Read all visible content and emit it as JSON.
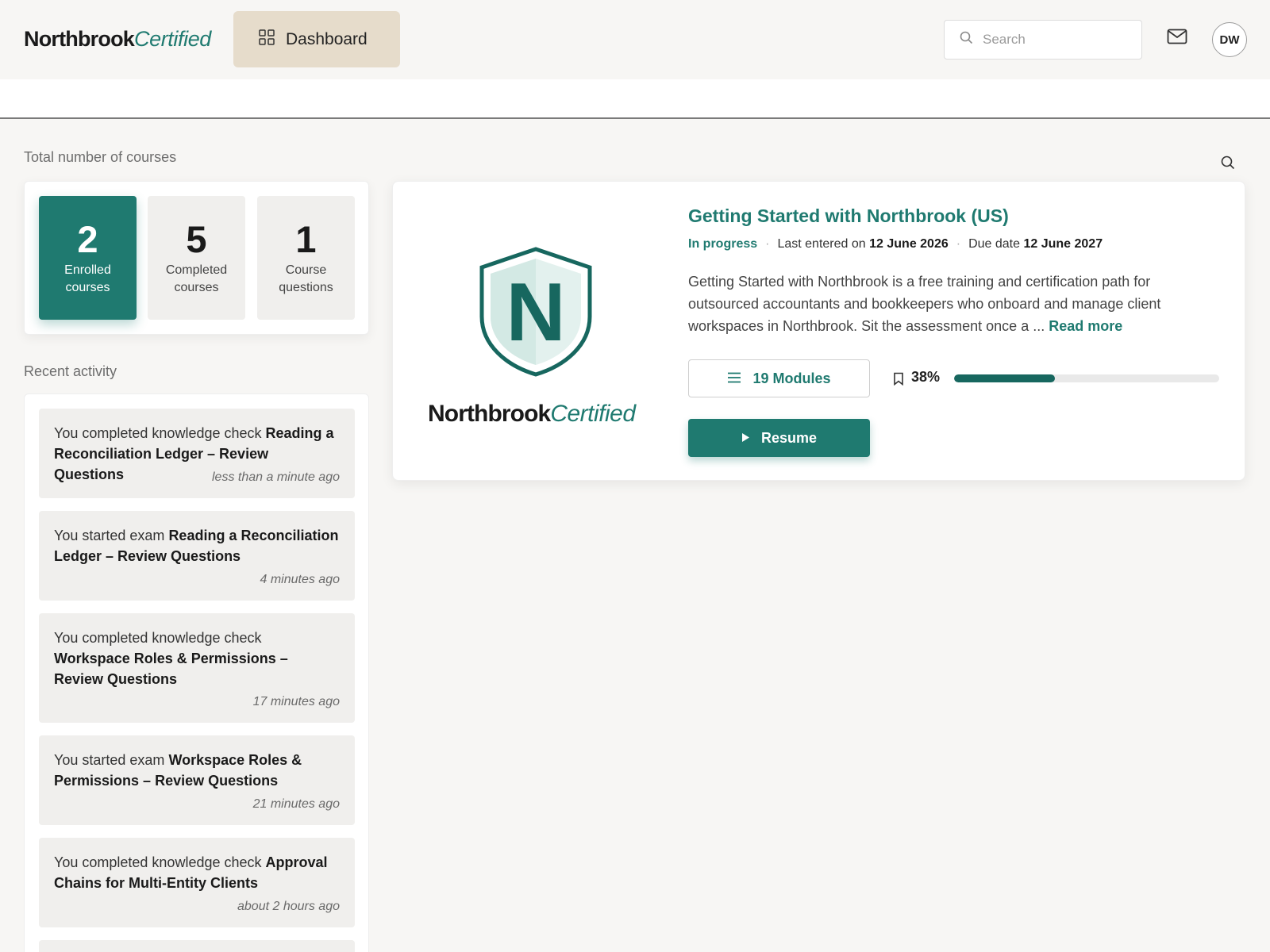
{
  "header": {
    "logo_main": "Northbrook",
    "logo_accent": "Certified",
    "dashboard_label": "Dashboard",
    "dashboard_icon": "grid-icon",
    "search_placeholder": "Search",
    "mail_icon": "mail-icon",
    "avatar_initials": "DW"
  },
  "stats": {
    "section_label": "Total number of courses",
    "items": [
      {
        "value": "2",
        "line1": "Enrolled",
        "line2": "courses",
        "active": true
      },
      {
        "value": "5",
        "line1": "Completed",
        "line2": "courses",
        "active": false
      },
      {
        "value": "1",
        "line1": "Course",
        "line2": "questions",
        "active": false
      }
    ]
  },
  "activity": {
    "section_label": "Recent activity",
    "items": [
      {
        "prefix": "You completed knowledge check",
        "title": "Reading a Reconciliation Ledger – Review Questions",
        "time": "less than a minute ago"
      },
      {
        "prefix": "You started exam",
        "title": "Reading a Reconciliation Ledger – Review Questions",
        "time": "4 minutes ago"
      },
      {
        "prefix": "You completed knowledge check",
        "title": "Workspace Roles & Permissions – Review Questions",
        "time": "17 minutes ago"
      },
      {
        "prefix": "You started exam",
        "title": "Workspace Roles & Permissions – Review Questions",
        "time": "21 minutes ago"
      },
      {
        "prefix": "You completed knowledge check",
        "title": "Approval Chains for Multi-Entity Clients",
        "time": "about 2 hours ago"
      }
    ]
  },
  "course": {
    "title": "Getting Started with Northbrook (US)",
    "status": "In progress",
    "last_entered_label": "Last entered on",
    "last_entered_date": "12 June 2026",
    "due_label": "Due date",
    "due_date": "12 June 2027",
    "description": "Getting Started with Northbrook is a free training and certification path for outsourced accountants and bookkeepers who onboard and manage client workspaces in Northbrook. Sit the assessment once a ...",
    "read_more": "Read more",
    "logo_main": "Northbrook",
    "logo_accent": "Certified",
    "shield_letter": "N",
    "modules_label": "19 Modules",
    "progress_percent": 38,
    "progress_label": "38%",
    "resume_label": "Resume"
  },
  "colors": {
    "brand": "#1f7a70",
    "brand_dark": "#17675f",
    "dashboard_bg": "#e6dccb"
  }
}
